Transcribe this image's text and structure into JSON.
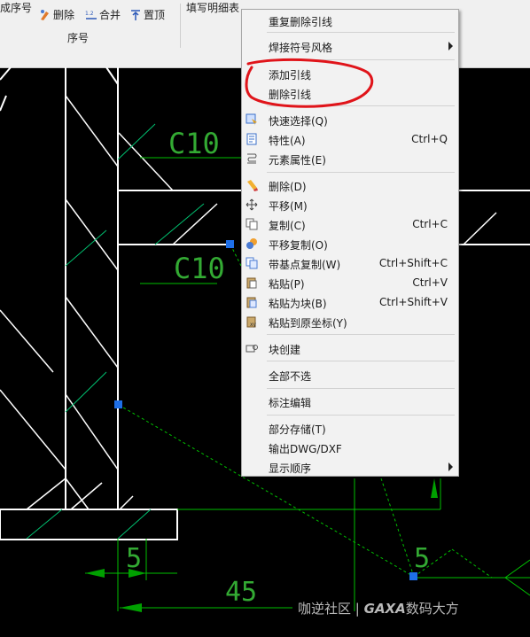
{
  "ribbon": {
    "left_label": "成序号",
    "delete_label": "删除",
    "merge_label": "合并",
    "top_label": "置顶",
    "group_label": "序号",
    "fill_label": "填写明细表"
  },
  "canvas": {
    "labels": {
      "c10_top": "C10",
      "c10_bottom": "C10",
      "dim_5_left": "5",
      "dim_45": "45",
      "dim_5_right": "5"
    },
    "colors": {
      "line": "#ffffff",
      "hatch": "#00c070",
      "dim": "#00c000",
      "text": "#33aa33",
      "grip": "#1e6fe8"
    }
  },
  "context_menu": {
    "items": [
      {
        "label": "重复删除引线",
        "shortcut": "",
        "icon": "",
        "submenu": false
      },
      {
        "label": "焊接符号风格",
        "shortcut": "",
        "icon": "",
        "submenu": true
      },
      {
        "label": "添加引线",
        "shortcut": "",
        "icon": "",
        "submenu": false
      },
      {
        "label": "删除引线",
        "shortcut": "",
        "icon": "",
        "submenu": false
      },
      {
        "label": "快速选择(Q)",
        "shortcut": "",
        "icon": "quick-select-icon",
        "submenu": false
      },
      {
        "label": "特性(A)",
        "shortcut": "Ctrl+Q",
        "icon": "properties-icon",
        "submenu": false
      },
      {
        "label": "元素属性(E)",
        "shortcut": "",
        "icon": "element-attributes-icon",
        "submenu": false
      },
      {
        "label": "删除(D)",
        "shortcut": "",
        "icon": "eraser-icon",
        "submenu": false
      },
      {
        "label": "平移(M)",
        "shortcut": "",
        "icon": "move-icon",
        "submenu": false
      },
      {
        "label": "复制(C)",
        "shortcut": "Ctrl+C",
        "icon": "copy-icon",
        "submenu": false
      },
      {
        "label": "平移复制(O)",
        "shortcut": "",
        "icon": "move-copy-icon",
        "submenu": false
      },
      {
        "label": "带基点复制(W)",
        "shortcut": "Ctrl+Shift+C",
        "icon": "copy-base-point-icon",
        "submenu": false
      },
      {
        "label": "粘贴(P)",
        "shortcut": "Ctrl+V",
        "icon": "paste-icon",
        "submenu": false
      },
      {
        "label": "粘贴为块(B)",
        "shortcut": "Ctrl+Shift+V",
        "icon": "paste-block-icon",
        "submenu": false
      },
      {
        "label": "粘贴到原坐标(Y)",
        "shortcut": "",
        "icon": "paste-original-coords-icon",
        "submenu": false
      },
      {
        "label": "块创建",
        "shortcut": "",
        "icon": "block-create-icon",
        "submenu": false
      },
      {
        "label": "全部不选",
        "shortcut": "",
        "icon": "",
        "submenu": false
      },
      {
        "label": "标注编辑",
        "shortcut": "",
        "icon": "",
        "submenu": false
      },
      {
        "label": "部分存储(T)",
        "shortcut": "",
        "icon": "",
        "submenu": false
      },
      {
        "label": "输出DWG/DXF",
        "shortcut": "",
        "icon": "",
        "submenu": false
      },
      {
        "label": "显示顺序",
        "shortcut": "",
        "icon": "",
        "submenu": true
      }
    ]
  },
  "watermark": {
    "part1": "咖逆社区",
    "divider": "|",
    "part2": "GAXA",
    "part3": "数码大方"
  }
}
